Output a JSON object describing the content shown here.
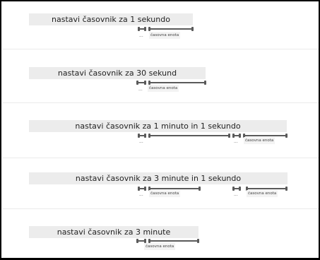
{
  "rows": [
    {
      "title": "nastavi časovnik za 1 sekundo",
      "fields": [
        {
          "ellipsis": "...",
          "unit_label": "časovna enota"
        }
      ]
    },
    {
      "title": "nastavi časovnik za 30 sekund",
      "fields": [
        {
          "ellipsis": "...",
          "unit_label": "časovna enota"
        }
      ]
    },
    {
      "title": "nastavi časovnik za 1 minuto in 1 sekundo",
      "fields": [
        {
          "ellipsis": "...",
          "unit_label": "časovna enota"
        },
        {
          "ellipsis": "...",
          "unit_label": "časovna enota"
        }
      ]
    },
    {
      "title": "nastavi časovnik za 3 minute in 1 sekundo",
      "fields": [
        {
          "ellipsis": "...",
          "unit_label": "časovna enota"
        },
        {
          "ellipsis": "...",
          "unit_label": "časovna enota"
        }
      ]
    },
    {
      "title": "nastavi časovnik za 3 minute",
      "fields": [
        {
          "ellipsis": "...",
          "unit_label": "časovna enota"
        }
      ]
    }
  ]
}
